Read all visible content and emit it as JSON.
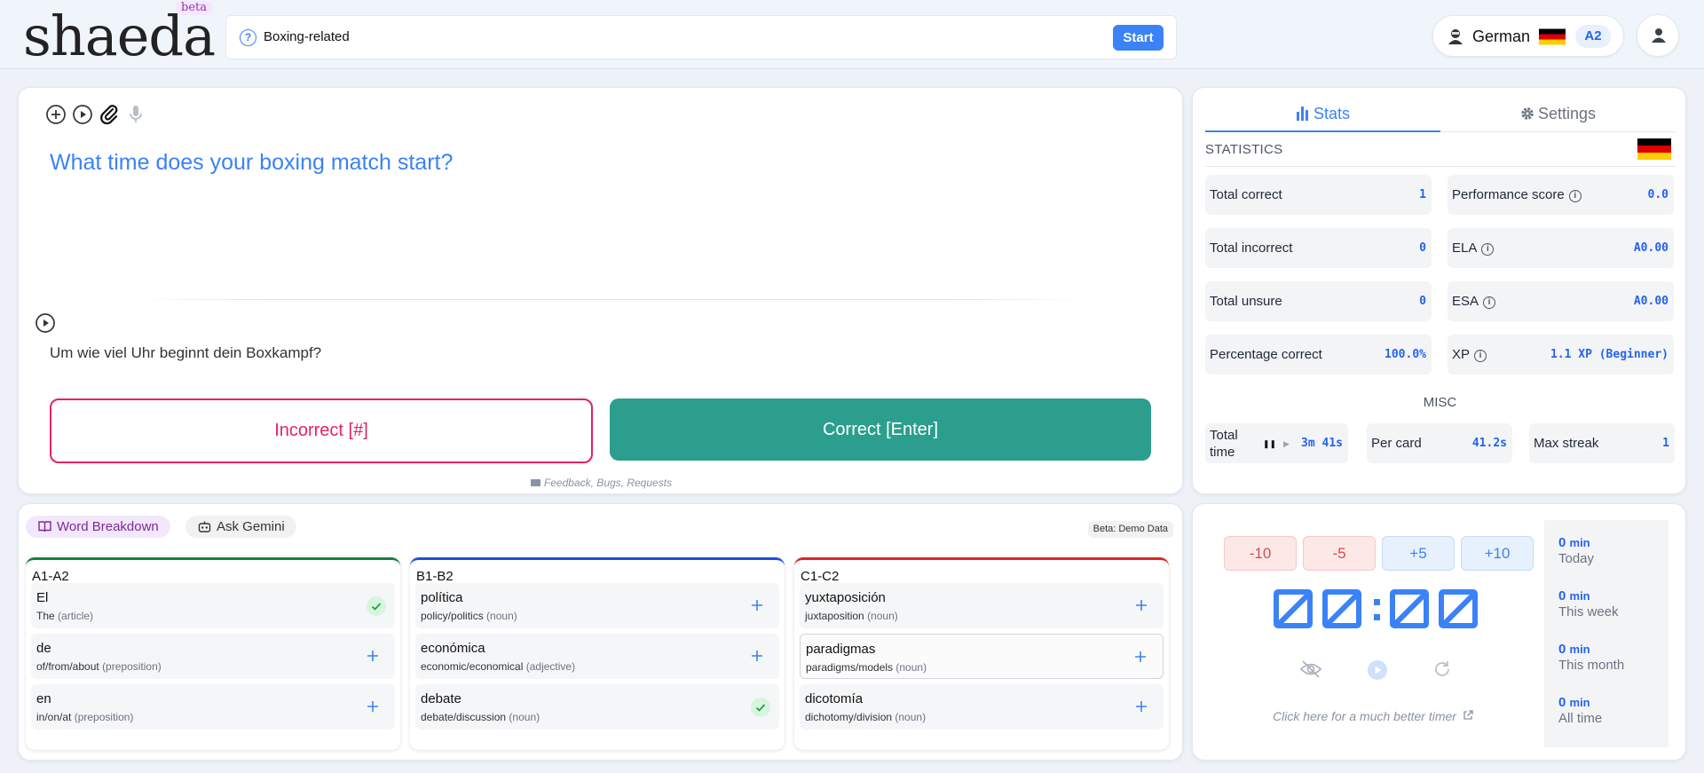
{
  "header": {
    "logo": "shaeda",
    "logo_tag": "beta",
    "topic": "Boxing-related",
    "start_label": "Start",
    "language": "German",
    "level": "A2"
  },
  "card": {
    "question": "What time does your boxing match start?",
    "answer": "Um wie viel Uhr beginnt dein Boxkampf?",
    "incorrect_label": "Incorrect [#]",
    "correct_label": "Correct [Enter]",
    "feedback_label": "Feedback, Bugs, Requests"
  },
  "stats": {
    "tab_stats": "Stats",
    "tab_settings": "Settings",
    "heading": "STATISTICS",
    "items": [
      {
        "label": "Total correct",
        "value": "1"
      },
      {
        "label": "Performance score",
        "value": "0.0"
      },
      {
        "label": "Total incorrect",
        "value": "0"
      },
      {
        "label": "ELA",
        "value": "A0.00"
      },
      {
        "label": "Total unsure",
        "value": "0"
      },
      {
        "label": "ESA",
        "value": "A0.00"
      },
      {
        "label": "Percentage correct",
        "value": "100.0%"
      },
      {
        "label": "XP",
        "value": "1.1 XP (Beginner)"
      }
    ],
    "misc_heading": "MISC",
    "misc": [
      {
        "label": "Total time",
        "value": "3m 41s"
      },
      {
        "label": "Per card",
        "value": "41.2s"
      },
      {
        "label": "Max streak",
        "value": "1"
      }
    ]
  },
  "words": {
    "tab_breakdown": "Word Breakdown",
    "tab_gemini": "Ask Gemini",
    "beta_note": "Beta: Demo Data",
    "columns": [
      {
        "title": "A1-A2",
        "color": "#15803d",
        "items": [
          {
            "word": "El",
            "meaning": "The",
            "pos": "(article)",
            "state": "added"
          },
          {
            "word": "de",
            "meaning": "of/from/about",
            "pos": "(preposition)",
            "state": "add"
          },
          {
            "word": "en",
            "meaning": "in/on/at",
            "pos": "(preposition)",
            "state": "add"
          }
        ]
      },
      {
        "title": "B1-B2",
        "color": "#1d4ed8",
        "items": [
          {
            "word": "política",
            "meaning": "policy/politics",
            "pos": "(noun)",
            "state": "add"
          },
          {
            "word": "económica",
            "meaning": "economic/economical",
            "pos": "(adjective)",
            "state": "add"
          },
          {
            "word": "debate",
            "meaning": "debate/discussion",
            "pos": "(noun)",
            "state": "added"
          }
        ]
      },
      {
        "title": "C1-C2",
        "color": "#dc2626",
        "items": [
          {
            "word": "yuxtaposición",
            "meaning": "juxtaposition",
            "pos": "(noun)",
            "state": "add"
          },
          {
            "word": "paradigmas",
            "meaning": "paradigms/models",
            "pos": "(noun)",
            "state": "add"
          },
          {
            "word": "dicotomía",
            "meaning": "dichotomy/division",
            "pos": "(noun)",
            "state": "add"
          }
        ]
      }
    ]
  },
  "timer": {
    "adjust": [
      "-10",
      "-5",
      "+5",
      "+10"
    ],
    "display": "00:00",
    "better_timer_label": "Click here for a much better timer",
    "summary": [
      {
        "value": "0",
        "unit": "min",
        "label": "Today"
      },
      {
        "value": "0",
        "unit": "min",
        "label": "This week"
      },
      {
        "value": "0",
        "unit": "min",
        "label": "This month"
      },
      {
        "value": "0",
        "unit": "min",
        "label": "All time"
      }
    ]
  },
  "colors": {
    "accent": "#3b82f6",
    "correct": "#2b9e8e",
    "incorrect": "#e3245d",
    "brand_tag": "#9b30b8"
  }
}
